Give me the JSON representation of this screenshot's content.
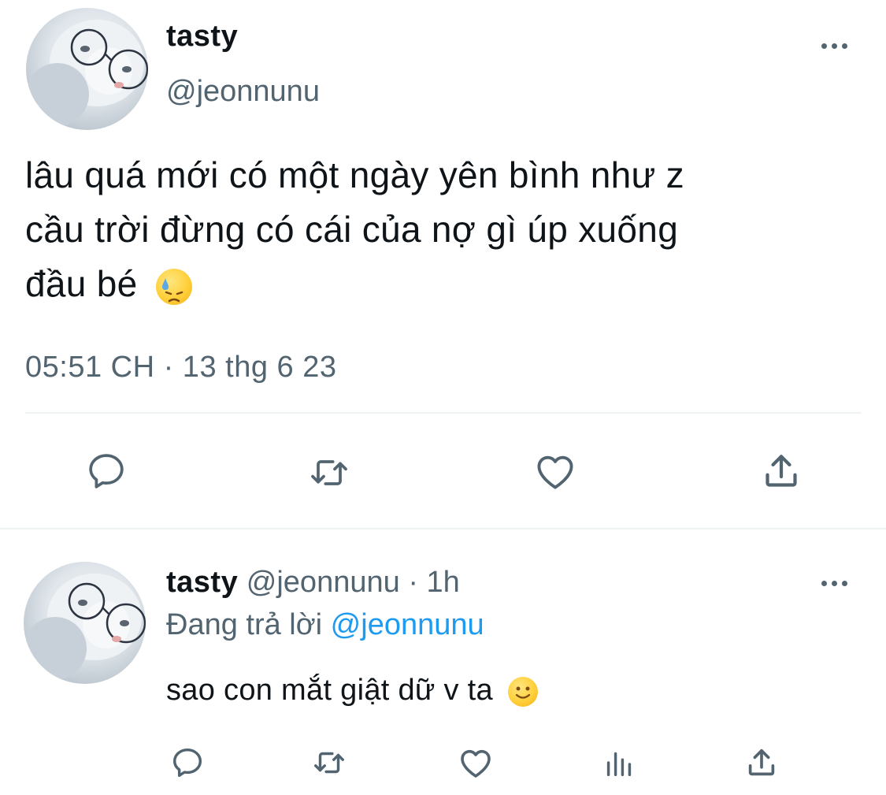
{
  "main_tweet": {
    "author_name": "tasty",
    "author_handle": "@jeonnunu",
    "text_line1": "lâu quá mới có một ngày yên bình như z",
    "text_line2": "cầu trời đừng có cái của nợ gì úp xuống",
    "text_line3": "đầu bé",
    "emoji": "downcast-face-with-sweat",
    "timestamp": "05:51 CH · 13 thg 6 23",
    "actions": [
      "reply-icon",
      "retweet-icon",
      "like-icon",
      "share-icon"
    ]
  },
  "reply_tweet": {
    "author_name": "tasty",
    "author_handle": "@jeonnunu",
    "separator": "·",
    "time_ago": "1h",
    "replying_prefix": "Đang trả lời",
    "replying_to": "@jeonnunu",
    "text": "sao con mắt giật dữ v ta",
    "emoji": "slightly-smiling-face",
    "actions": [
      "reply-icon",
      "retweet-icon",
      "like-icon",
      "views-icon",
      "share-icon"
    ]
  },
  "colors": {
    "text": "#0f1419",
    "muted": "#536471",
    "link": "#1d9bf0",
    "divider": "#eff3f4"
  }
}
